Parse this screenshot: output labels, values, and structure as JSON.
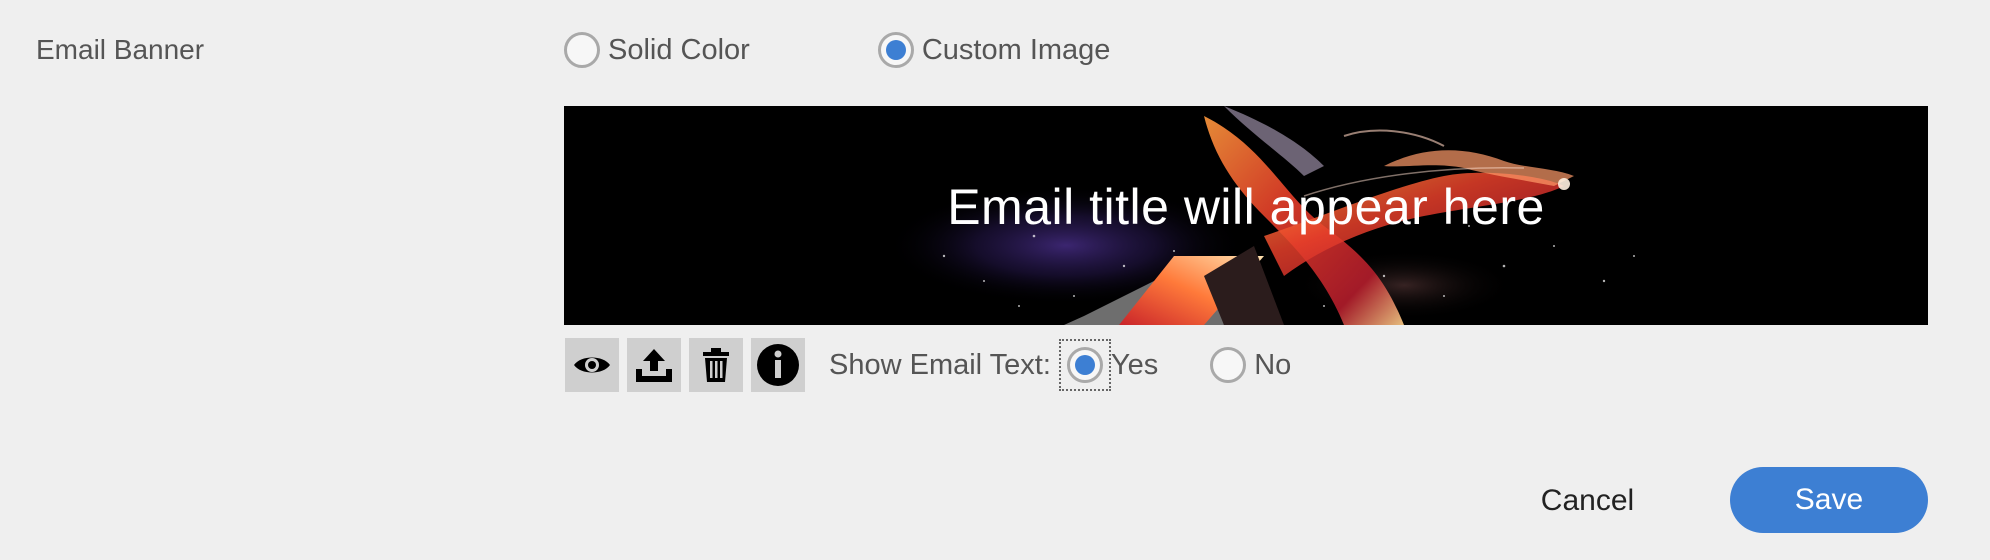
{
  "email_banner": {
    "label": "Email Banner",
    "options": [
      {
        "label": "Solid Color",
        "selected": false
      },
      {
        "label": "Custom Image",
        "selected": true
      }
    ]
  },
  "banner_preview": {
    "title": "Email title will appear here"
  },
  "toolbar": {
    "icons": [
      "eye-icon",
      "upload-icon",
      "trash-icon",
      "info-icon"
    ]
  },
  "show_email_text": {
    "label": "Show Email Text:",
    "options": [
      {
        "label": "Yes",
        "selected": true
      },
      {
        "label": "No",
        "selected": false
      }
    ]
  },
  "actions": {
    "cancel": "Cancel",
    "save": "Save"
  },
  "colors": {
    "accent": "#3d7fd3",
    "background": "#efefef",
    "tool_button": "#cfcfcf"
  }
}
